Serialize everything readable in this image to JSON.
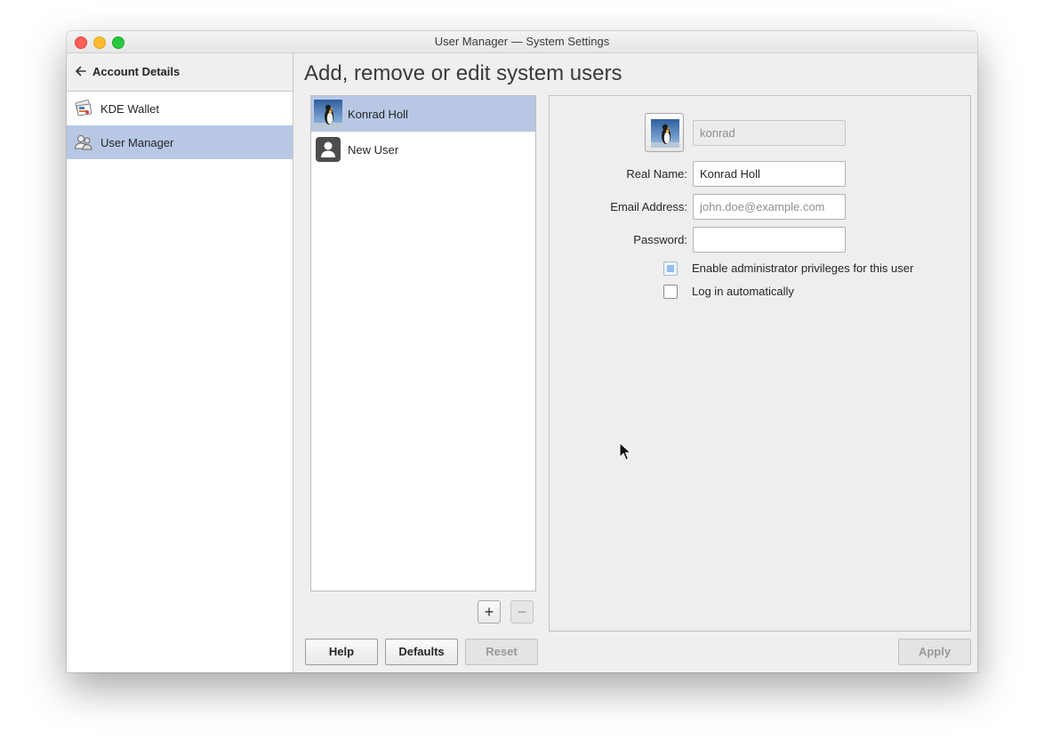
{
  "window": {
    "title": "User Manager — System Settings"
  },
  "sidebar": {
    "header": {
      "label": "Account Details",
      "icon": "back-arrow-icon"
    },
    "items": [
      {
        "label": "KDE Wallet",
        "icon": "kde-wallet-icon",
        "selected": false
      },
      {
        "label": "User Manager",
        "icon": "users-icon",
        "selected": true
      }
    ]
  },
  "main": {
    "title": "Add, remove or edit system users",
    "users": [
      {
        "name": "Konrad Holl",
        "avatar": "penguin-avatar-icon",
        "selected": true
      },
      {
        "name": "New User",
        "avatar": "generic-user-icon",
        "selected": false
      }
    ],
    "list_buttons": {
      "add": "+",
      "remove": "−"
    },
    "details": {
      "username": {
        "value": "konrad"
      },
      "real_name": {
        "label": "Real Name:",
        "value": "Konrad Holl"
      },
      "email": {
        "label": "Email Address:",
        "placeholder": "john.doe@example.com"
      },
      "password": {
        "label": "Password:",
        "value": ""
      },
      "admin": {
        "label": "Enable administrator privileges for this user",
        "checked": true
      },
      "autologin": {
        "label": "Log in automatically",
        "checked": false
      }
    }
  },
  "footer": {
    "help": "Help",
    "defaults": "Defaults",
    "reset": "Reset",
    "apply": "Apply"
  },
  "colors": {
    "selection": "#b8c8e4",
    "window_bg": "#efefef",
    "checkbox_accent": "#93bff2"
  }
}
